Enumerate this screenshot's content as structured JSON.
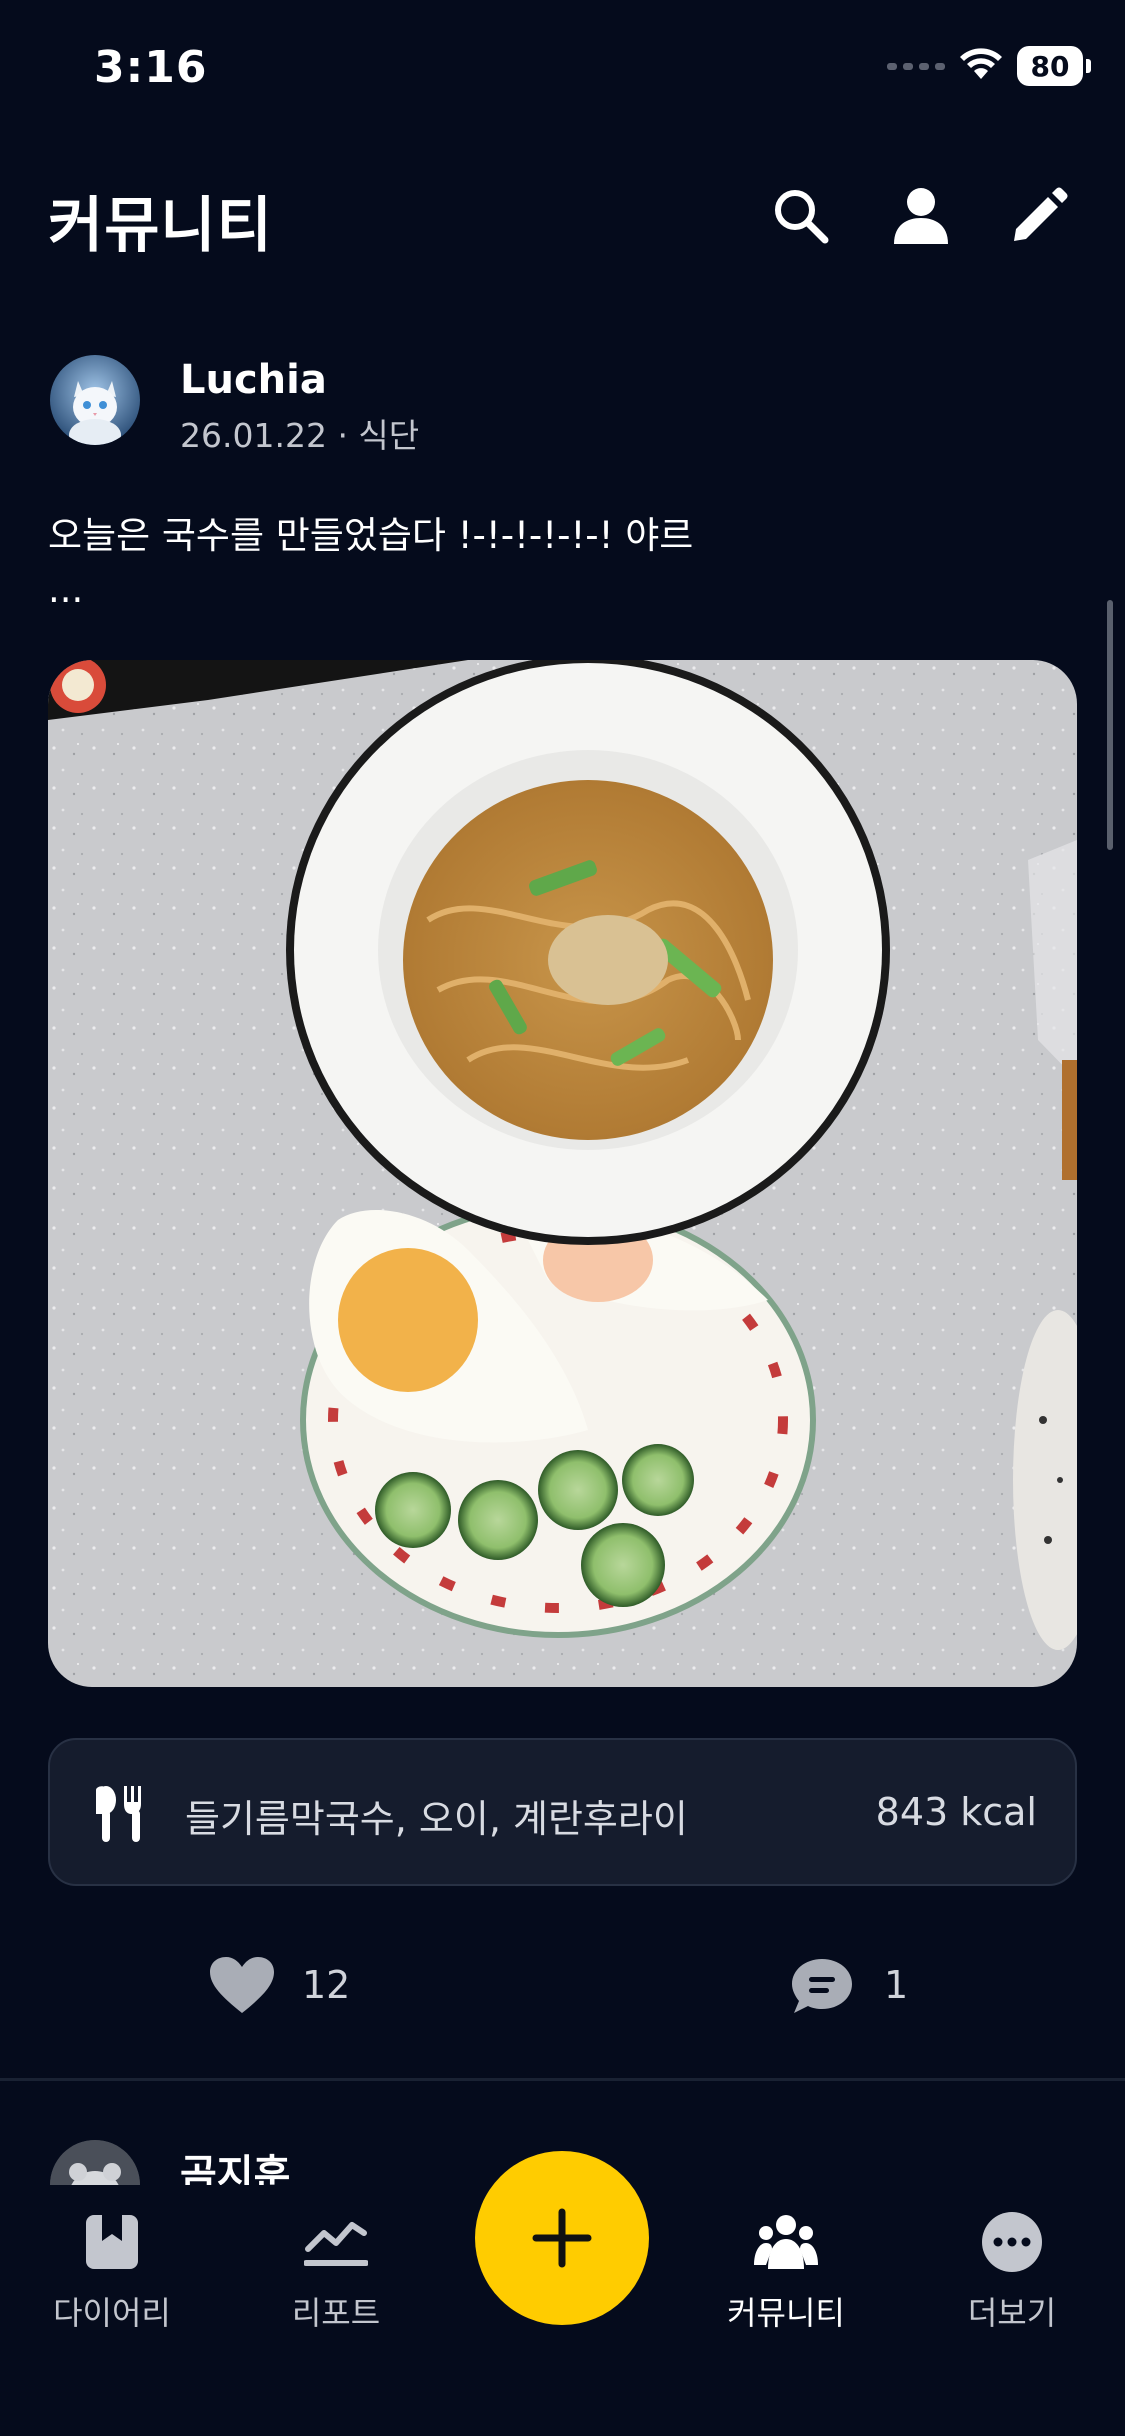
{
  "status_bar": {
    "time": "3:16",
    "battery": "80"
  },
  "header": {
    "title": "커뮤니티"
  },
  "post": {
    "author": "Luchia",
    "meta": "26.01.22 · 식단",
    "text": "오늘은 국수를 만들었습다 !-!-!-!-!-! 야르",
    "more": "...",
    "meal": {
      "foods": "들기름막국수, 오이, 계란후라이",
      "kcal": "843 kcal"
    },
    "likes": "12",
    "comments": "1"
  },
  "next_post": {
    "author": "곰지훈"
  },
  "tab_bar": {
    "tabs": [
      {
        "label": "다이어리",
        "icon": "diary-icon"
      },
      {
        "label": "리포트",
        "icon": "report-icon"
      },
      {
        "label": "커뮤니티",
        "icon": "community-icon",
        "active": true
      },
      {
        "label": "더보기",
        "icon": "more-icon"
      }
    ],
    "fab_icon": "plus-icon"
  },
  "colors": {
    "background": "#050b1c",
    "accent": "#ffcc00",
    "card": "#151c2d"
  }
}
